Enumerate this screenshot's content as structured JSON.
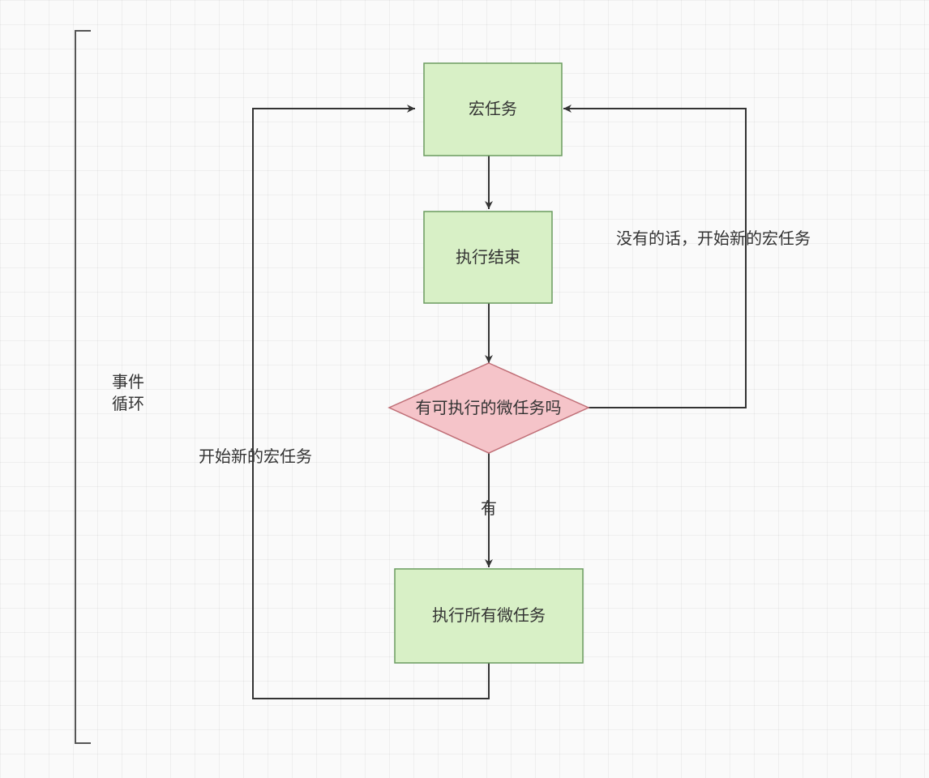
{
  "diagram": {
    "bracket_label_line1": "事件",
    "bracket_label_line2": "循环",
    "nodes": {
      "macro_task": "宏任务",
      "exec_done": "执行结束",
      "has_microtask": "有可执行的微任务吗",
      "run_all_micro": "执行所有微任务"
    },
    "edges": {
      "yes_label": "有",
      "no_label": "没有的话，开始新的宏任务",
      "restart_label": "开始新的宏任务"
    }
  }
}
